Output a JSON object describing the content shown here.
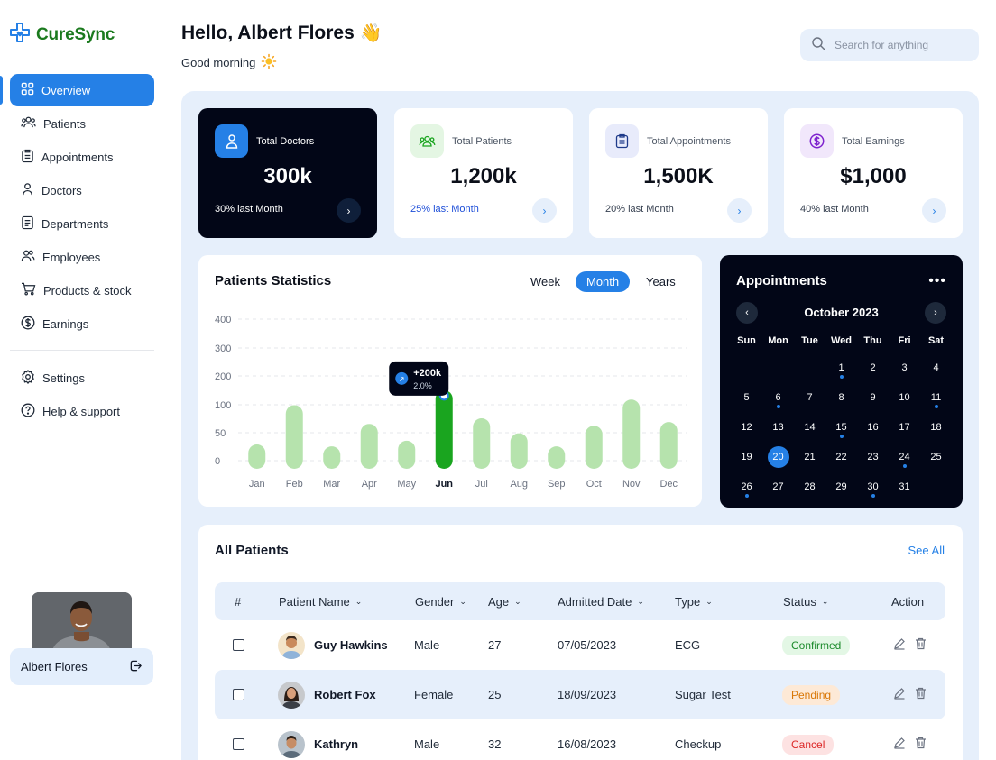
{
  "brand": {
    "name": "CureSync"
  },
  "nav": {
    "items": [
      {
        "label": "Overview"
      },
      {
        "label": "Patients"
      },
      {
        "label": "Appointments"
      },
      {
        "label": "Doctors"
      },
      {
        "label": "Departments"
      },
      {
        "label": "Employees"
      },
      {
        "label": "Products & stock"
      },
      {
        "label": "Earnings"
      }
    ],
    "secondary": [
      {
        "label": "Settings"
      },
      {
        "label": "Help & support"
      }
    ]
  },
  "user": {
    "name": "Albert Flores"
  },
  "header": {
    "greeting": "Hello, Albert Flores",
    "wave": "👋",
    "subtitle": "Good morning",
    "search_placeholder": "Search for anything"
  },
  "stats": [
    {
      "label": "Total Doctors",
      "value": "300k",
      "note": "30% last Month"
    },
    {
      "label": "Total Patients",
      "value": "1,200k",
      "note": "25% last Month"
    },
    {
      "label": "Total Appointments",
      "value": "1,500K",
      "note": "20% last Month"
    },
    {
      "label": "Total Earnings",
      "value": "$1,000",
      "note": "40% last Month"
    }
  ],
  "chart": {
    "title": "Patients Statistics",
    "ranges": [
      "Week",
      "Month",
      "Years"
    ],
    "selected_range": "Month",
    "tooltip": {
      "value": "+200k",
      "pct": "2.0%"
    }
  },
  "chart_data": {
    "type": "bar",
    "title": "Patients Statistics",
    "categories": [
      "Jan",
      "Feb",
      "Mar",
      "Apr",
      "May",
      "Jun",
      "Jul",
      "Aug",
      "Sep",
      "Oct",
      "Nov",
      "Dec"
    ],
    "values": [
      65,
      170,
      60,
      120,
      75,
      210,
      135,
      95,
      60,
      115,
      185,
      125
    ],
    "highlight_index": 5,
    "yticks": [
      400,
      300,
      200,
      100,
      50,
      0
    ],
    "ylim": [
      0,
      400
    ],
    "grid": true,
    "colors": {
      "bar": "#b6e3ad",
      "highlight": "#1aa51f"
    }
  },
  "calendar": {
    "title": "Appointments",
    "month": "October 2023",
    "weekdays": [
      "Sun",
      "Mon",
      "Tue",
      "Wed",
      "Thu",
      "Fri",
      "Sat"
    ],
    "first_weekday": 3,
    "days_in_month": 31,
    "selected": 20,
    "marked": [
      1,
      6,
      11,
      15,
      24,
      26,
      30
    ]
  },
  "patients": {
    "title": "All Patients",
    "see_all": "See All",
    "columns": [
      "#",
      "Patient Name",
      "Gender",
      "Age",
      "Admitted Date",
      "Type",
      "Status",
      "Action"
    ],
    "rows": [
      {
        "name": "Guy Hawkins",
        "gender": "Male",
        "age": "27",
        "date": "07/05/2023",
        "type": "ECG",
        "status": "Confirmed"
      },
      {
        "name": "Robert Fox",
        "gender": "Female",
        "age": "25",
        "date": "18/09/2023",
        "type": "Sugar Test",
        "status": "Pending"
      },
      {
        "name": "Kathryn",
        "gender": "Male",
        "age": "32",
        "date": "16/08/2023",
        "type": "Checkup",
        "status": "Cancel"
      }
    ]
  }
}
